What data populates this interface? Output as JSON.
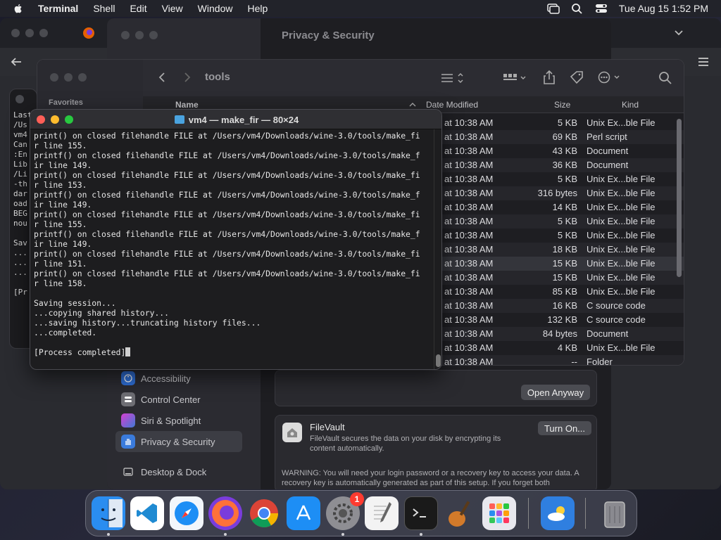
{
  "menubar": {
    "app_name": "Terminal",
    "items": [
      "Shell",
      "Edit",
      "View",
      "Window",
      "Help"
    ],
    "clock": "Tue Aug 15  1:52 PM"
  },
  "settings": {
    "title": "Privacy & Security",
    "sidebar": [
      {
        "label": "Accessibility",
        "icon": "accessibility-icon"
      },
      {
        "label": "Control Center",
        "icon": "control-center-icon"
      },
      {
        "label": "Siri & Spotlight",
        "icon": "siri-icon"
      },
      {
        "label": "Privacy & Security",
        "icon": "hand-icon",
        "selected": true
      },
      {
        "label": "Desktop & Dock",
        "icon": "desktop-dock-icon"
      }
    ],
    "open_anyway": "Open Anyway",
    "filevault": {
      "title": "FileVault",
      "desc": "FileVault secures the data on your disk by encrypting its content automatically.",
      "button": "Turn On...",
      "warning": "WARNING: You will need your login password or a recovery key to access your data. A recovery key is automatically generated as part of this setup. If you forget both"
    }
  },
  "finder": {
    "title": "tools",
    "sidebar_heading": "Favorites",
    "columns": {
      "name": "Name",
      "date": "Date Modified",
      "size": "Size",
      "kind": "Kind"
    },
    "rows": [
      {
        "date": "at 10:38 AM",
        "size": "5 KB",
        "kind": "Unix Ex...ble File"
      },
      {
        "date": "at 10:38 AM",
        "size": "69 KB",
        "kind": "Perl script"
      },
      {
        "date": "at 10:38 AM",
        "size": "43 KB",
        "kind": "Document"
      },
      {
        "date": "at 10:38 AM",
        "size": "36 KB",
        "kind": "Document"
      },
      {
        "date": "at 10:38 AM",
        "size": "5 KB",
        "kind": "Unix Ex...ble File"
      },
      {
        "date": "at 10:38 AM",
        "size": "316 bytes",
        "kind": "Unix Ex...ble File"
      },
      {
        "date": "at 10:38 AM",
        "size": "14 KB",
        "kind": "Unix Ex...ble File"
      },
      {
        "date": "at 10:38 AM",
        "size": "5 KB",
        "kind": "Unix Ex...ble File"
      },
      {
        "date": "at 10:38 AM",
        "size": "5 KB",
        "kind": "Unix Ex...ble File"
      },
      {
        "date": "at 10:38 AM",
        "size": "18 KB",
        "kind": "Unix Ex...ble File"
      },
      {
        "date": "at 10:38 AM",
        "size": "15 KB",
        "kind": "Unix Ex...ble File"
      },
      {
        "date": "at 10:38 AM",
        "size": "15 KB",
        "kind": "Unix Ex...ble File"
      },
      {
        "date": "at 10:38 AM",
        "size": "85 KB",
        "kind": "Unix Ex...ble File"
      },
      {
        "date": "at 10:38 AM",
        "size": "16 KB",
        "kind": "C source code"
      },
      {
        "date": "at 10:38 AM",
        "size": "132 KB",
        "kind": "C source code"
      },
      {
        "date": "at 10:38 AM",
        "size": "84 bytes",
        "kind": "Document"
      },
      {
        "date": "at 10:38 AM",
        "size": "4 KB",
        "kind": "Unix Ex...ble File"
      },
      {
        "date": "at 10:38 AM",
        "size": "--",
        "kind": "Folder"
      }
    ]
  },
  "terminal_back": {
    "lines": [
      "Last",
      "/Us",
      "vm4",
      "Can",
      ":En",
      "Lib",
      "/Li",
      "-th",
      "dar",
      "oad",
      "BEG",
      "nou",
      "",
      "Sav",
      "...",
      "...",
      "...",
      "",
      "[Pr"
    ]
  },
  "terminal": {
    "title": "vm4 — make_fir — 80×24",
    "lines": [
      "print() on closed filehandle FILE at /Users/vm4/Downloads/wine-3.0/tools/make_fi",
      "r line 155.",
      "printf() on closed filehandle FILE at /Users/vm4/Downloads/wine-3.0/tools/make_f",
      "ir line 149.",
      "print() on closed filehandle FILE at /Users/vm4/Downloads/wine-3.0/tools/make_fi",
      "r line 153.",
      "printf() on closed filehandle FILE at /Users/vm4/Downloads/wine-3.0/tools/make_f",
      "ir line 149.",
      "print() on closed filehandle FILE at /Users/vm4/Downloads/wine-3.0/tools/make_fi",
      "r line 155.",
      "printf() on closed filehandle FILE at /Users/vm4/Downloads/wine-3.0/tools/make_f",
      "ir line 149.",
      "print() on closed filehandle FILE at /Users/vm4/Downloads/wine-3.0/tools/make_fi",
      "r line 151.",
      "print() on closed filehandle FILE at /Users/vm4/Downloads/wine-3.0/tools/make_fi",
      "r line 158.",
      "",
      "Saving session...",
      "...copying shared history...",
      "...saving history...truncating history files...",
      "...completed.",
      "",
      "[Process completed]"
    ]
  },
  "dock": [
    {
      "name": "Finder",
      "icon": "finder-icon",
      "color": "#2a8df0",
      "running": true
    },
    {
      "name": "Visual Studio Code",
      "icon": "vscode-icon",
      "color": "#ffffff",
      "running": false
    },
    {
      "name": "Safari",
      "icon": "safari-icon",
      "color": "#f2f6fb",
      "running": false
    },
    {
      "name": "Firefox",
      "icon": "firefox-icon",
      "color": "#7a3cdc",
      "running": true
    },
    {
      "name": "Chrome",
      "icon": "chrome-icon",
      "color": "#ffffff",
      "running": false
    },
    {
      "name": "App Store",
      "icon": "app-store-icon",
      "color": "#1d8ef5",
      "running": false
    },
    {
      "name": "System Settings",
      "icon": "gear-icon",
      "color": "#8e8e93",
      "running": true,
      "badge": "1"
    },
    {
      "name": "TextEdit",
      "icon": "textedit-icon",
      "color": "#f3f3f3",
      "running": false
    },
    {
      "name": "Terminal",
      "icon": "terminal-icon",
      "color": "#1a1a1a",
      "running": true
    },
    {
      "name": "GarageBand",
      "icon": "guitar-icon",
      "color": "#3a2a1a",
      "running": false
    },
    {
      "name": "Launchpad",
      "icon": "launchpad-icon",
      "color": "#e8e8ee",
      "running": false
    },
    {
      "name": "Weather",
      "icon": "weather-icon",
      "color": "#2f7fe0",
      "running": false
    },
    {
      "name": "Trash",
      "icon": "trash-icon",
      "color": "#9a9aa0",
      "running": false
    }
  ]
}
